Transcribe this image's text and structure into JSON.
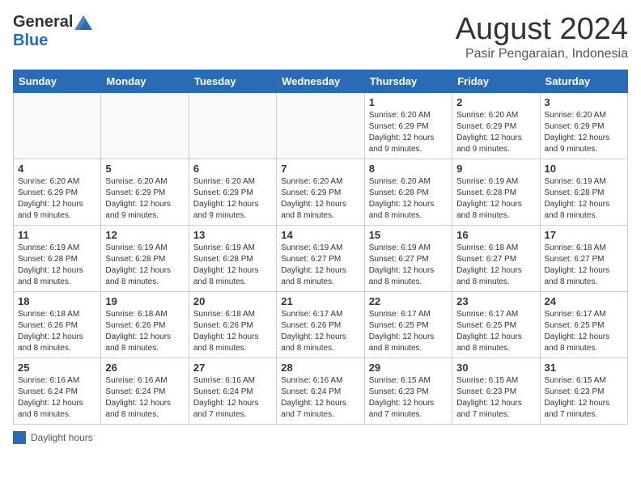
{
  "header": {
    "logo_general": "General",
    "logo_blue": "Blue",
    "month_title": "August 2024",
    "location": "Pasir Pengaraian, Indonesia"
  },
  "weekdays": [
    "Sunday",
    "Monday",
    "Tuesday",
    "Wednesday",
    "Thursday",
    "Friday",
    "Saturday"
  ],
  "legend_label": "Daylight hours",
  "weeks": [
    [
      {
        "day": "",
        "info": ""
      },
      {
        "day": "",
        "info": ""
      },
      {
        "day": "",
        "info": ""
      },
      {
        "day": "",
        "info": ""
      },
      {
        "day": "1",
        "info": "Sunrise: 6:20 AM\nSunset: 6:29 PM\nDaylight: 12 hours and 9 minutes."
      },
      {
        "day": "2",
        "info": "Sunrise: 6:20 AM\nSunset: 6:29 PM\nDaylight: 12 hours and 9 minutes."
      },
      {
        "day": "3",
        "info": "Sunrise: 6:20 AM\nSunset: 6:29 PM\nDaylight: 12 hours and 9 minutes."
      }
    ],
    [
      {
        "day": "4",
        "info": "Sunrise: 6:20 AM\nSunset: 6:29 PM\nDaylight: 12 hours and 9 minutes."
      },
      {
        "day": "5",
        "info": "Sunrise: 6:20 AM\nSunset: 6:29 PM\nDaylight: 12 hours and 9 minutes."
      },
      {
        "day": "6",
        "info": "Sunrise: 6:20 AM\nSunset: 6:29 PM\nDaylight: 12 hours and 9 minutes."
      },
      {
        "day": "7",
        "info": "Sunrise: 6:20 AM\nSunset: 6:29 PM\nDaylight: 12 hours and 8 minutes."
      },
      {
        "day": "8",
        "info": "Sunrise: 6:20 AM\nSunset: 6:28 PM\nDaylight: 12 hours and 8 minutes."
      },
      {
        "day": "9",
        "info": "Sunrise: 6:19 AM\nSunset: 6:28 PM\nDaylight: 12 hours and 8 minutes."
      },
      {
        "day": "10",
        "info": "Sunrise: 6:19 AM\nSunset: 6:28 PM\nDaylight: 12 hours and 8 minutes."
      }
    ],
    [
      {
        "day": "11",
        "info": "Sunrise: 6:19 AM\nSunset: 6:28 PM\nDaylight: 12 hours and 8 minutes."
      },
      {
        "day": "12",
        "info": "Sunrise: 6:19 AM\nSunset: 6:28 PM\nDaylight: 12 hours and 8 minutes."
      },
      {
        "day": "13",
        "info": "Sunrise: 6:19 AM\nSunset: 6:28 PM\nDaylight: 12 hours and 8 minutes."
      },
      {
        "day": "14",
        "info": "Sunrise: 6:19 AM\nSunset: 6:27 PM\nDaylight: 12 hours and 8 minutes."
      },
      {
        "day": "15",
        "info": "Sunrise: 6:19 AM\nSunset: 6:27 PM\nDaylight: 12 hours and 8 minutes."
      },
      {
        "day": "16",
        "info": "Sunrise: 6:18 AM\nSunset: 6:27 PM\nDaylight: 12 hours and 8 minutes."
      },
      {
        "day": "17",
        "info": "Sunrise: 6:18 AM\nSunset: 6:27 PM\nDaylight: 12 hours and 8 minutes."
      }
    ],
    [
      {
        "day": "18",
        "info": "Sunrise: 6:18 AM\nSunset: 6:26 PM\nDaylight: 12 hours and 8 minutes."
      },
      {
        "day": "19",
        "info": "Sunrise: 6:18 AM\nSunset: 6:26 PM\nDaylight: 12 hours and 8 minutes."
      },
      {
        "day": "20",
        "info": "Sunrise: 6:18 AM\nSunset: 6:26 PM\nDaylight: 12 hours and 8 minutes."
      },
      {
        "day": "21",
        "info": "Sunrise: 6:17 AM\nSunset: 6:26 PM\nDaylight: 12 hours and 8 minutes."
      },
      {
        "day": "22",
        "info": "Sunrise: 6:17 AM\nSunset: 6:25 PM\nDaylight: 12 hours and 8 minutes."
      },
      {
        "day": "23",
        "info": "Sunrise: 6:17 AM\nSunset: 6:25 PM\nDaylight: 12 hours and 8 minutes."
      },
      {
        "day": "24",
        "info": "Sunrise: 6:17 AM\nSunset: 6:25 PM\nDaylight: 12 hours and 8 minutes."
      }
    ],
    [
      {
        "day": "25",
        "info": "Sunrise: 6:16 AM\nSunset: 6:24 PM\nDaylight: 12 hours and 8 minutes."
      },
      {
        "day": "26",
        "info": "Sunrise: 6:16 AM\nSunset: 6:24 PM\nDaylight: 12 hours and 8 minutes."
      },
      {
        "day": "27",
        "info": "Sunrise: 6:16 AM\nSunset: 6:24 PM\nDaylight: 12 hours and 7 minutes."
      },
      {
        "day": "28",
        "info": "Sunrise: 6:16 AM\nSunset: 6:24 PM\nDaylight: 12 hours and 7 minutes."
      },
      {
        "day": "29",
        "info": "Sunrise: 6:15 AM\nSunset: 6:23 PM\nDaylight: 12 hours and 7 minutes."
      },
      {
        "day": "30",
        "info": "Sunrise: 6:15 AM\nSunset: 6:23 PM\nDaylight: 12 hours and 7 minutes."
      },
      {
        "day": "31",
        "info": "Sunrise: 6:15 AM\nSunset: 6:23 PM\nDaylight: 12 hours and 7 minutes."
      }
    ]
  ]
}
